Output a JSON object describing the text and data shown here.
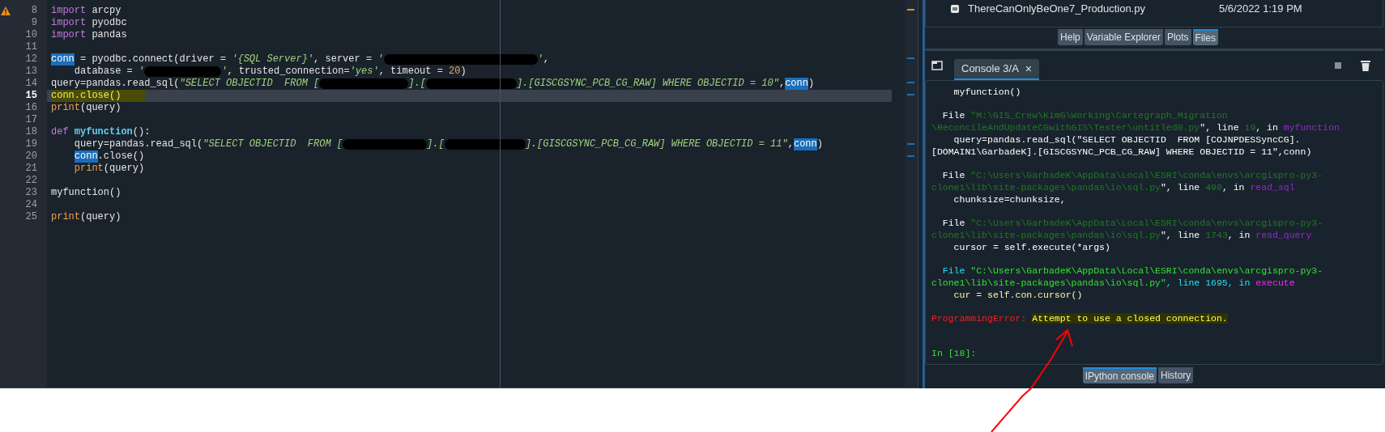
{
  "editor": {
    "lines": [
      {
        "number": "8",
        "warning": true,
        "current": false,
        "marked": false,
        "segments": [
          {
            "kind": "kw",
            "text": "import"
          },
          {
            "kind": "name",
            "text": " arcpy"
          }
        ]
      },
      {
        "number": "9",
        "warning": false,
        "current": false,
        "marked": false,
        "segments": [
          {
            "kind": "kw",
            "text": "import"
          },
          {
            "kind": "name",
            "text": " pyodbc"
          }
        ]
      },
      {
        "number": "10",
        "warning": false,
        "current": false,
        "marked": false,
        "segments": [
          {
            "kind": "kw",
            "text": "import"
          },
          {
            "kind": "name",
            "text": " pandas"
          }
        ]
      },
      {
        "number": "11",
        "warning": false,
        "current": false,
        "marked": false
      },
      {
        "number": "12",
        "warning": false,
        "current": false,
        "marked": false,
        "segments": [
          {
            "kind": "hl",
            "text": "conn"
          },
          {
            "kind": "name",
            "text": " = pyodbc.connect(driver = "
          },
          {
            "kind": "str",
            "text": "'{SQL Server}'"
          },
          {
            "kind": "name",
            "text": ", server = "
          },
          {
            "kind": "str",
            "text": "'"
          },
          {
            "kind": "redacted"
          },
          {
            "kind": "str",
            "text": "'"
          },
          {
            "kind": "name",
            "text": ","
          }
        ]
      },
      {
        "number": "13",
        "warning": false,
        "current": false,
        "marked": false,
        "segments": [
          {
            "kind": "name",
            "text": "    database = "
          },
          {
            "kind": "str",
            "text": "'"
          },
          {
            "kind": "redacted"
          },
          {
            "kind": "str",
            "text": "'"
          },
          {
            "kind": "name",
            "text": ", trusted_connection="
          },
          {
            "kind": "str",
            "text": "'yes'"
          },
          {
            "kind": "name",
            "text": ", timeout = "
          },
          {
            "kind": "num",
            "text": "20"
          },
          {
            "kind": "name",
            "text": ")"
          }
        ]
      },
      {
        "number": "14",
        "warning": false,
        "current": false,
        "marked": false,
        "segments": [
          {
            "kind": "name",
            "text": "query=pandas.read_sql("
          },
          {
            "kind": "str",
            "text": "\"SELECT OBJECTID  FROM ["
          },
          {
            "kind": "redacted"
          },
          {
            "kind": "str",
            "text": "].["
          },
          {
            "kind": "redacted"
          },
          {
            "kind": "str",
            "text": "].[GISCGSYNC_PCB_CG_RAW] WHERE OBJECTID = 10\""
          },
          {
            "kind": "name",
            "text": ","
          },
          {
            "kind": "hl",
            "text": "conn"
          },
          {
            "kind": "name",
            "text": ")"
          }
        ]
      },
      {
        "number": "15",
        "warning": false,
        "current": true,
        "marked": true,
        "segments": [
          {
            "kind": "name",
            "text": "conn.close()"
          }
        ]
      },
      {
        "number": "16",
        "warning": false,
        "current": false,
        "marked": false,
        "segments": [
          {
            "kind": "builtin",
            "text": "print"
          },
          {
            "kind": "name",
            "text": "(query)"
          }
        ]
      },
      {
        "number": "17",
        "warning": false,
        "current": false,
        "marked": false
      },
      {
        "number": "18",
        "warning": false,
        "current": false,
        "marked": false,
        "segments": [
          {
            "kind": "kw",
            "text": "def "
          },
          {
            "kind": "def",
            "text": "myfunction"
          },
          {
            "kind": "name",
            "text": "():"
          }
        ],
        "children": [
          {
            "number": "19",
            "warning": false,
            "current": false,
            "marked": false,
            "segments": [
              {
                "kind": "name",
                "text": "query=pandas.read_sql("
              },
              {
                "kind": "str",
                "text": "\"SELECT OBJECTID  FROM ["
              },
              {
                "kind": "redacted"
              },
              {
                "kind": "str",
                "text": "].["
              },
              {
                "kind": "redacted"
              },
              {
                "kind": "str",
                "text": "].[GISCGSYNC_PCB_CG_RAW] WHERE OBJECTID = 11\""
              },
              {
                "kind": "name",
                "text": ","
              },
              {
                "kind": "hl",
                "text": "conn"
              },
              {
                "kind": "name",
                "text": ")"
              }
            ]
          },
          {
            "number": "20",
            "warning": false,
            "current": false,
            "marked": false,
            "segments": [
              {
                "kind": "hl",
                "text": "conn"
              },
              {
                "kind": "name",
                "text": ".close()"
              }
            ]
          },
          {
            "number": "21",
            "warning": false,
            "current": false,
            "marked": false,
            "segments": [
              {
                "kind": "builtin",
                "text": "print"
              },
              {
                "kind": "name",
                "text": "(query)"
              }
            ]
          }
        ]
      },
      {
        "number": "22",
        "warning": false,
        "current": false,
        "marked": false
      },
      {
        "number": "23",
        "warning": false,
        "current": false,
        "marked": false,
        "segments": [
          {
            "kind": "name",
            "text": "myfunction()"
          }
        ]
      },
      {
        "number": "24",
        "warning": false,
        "current": false,
        "marked": false
      },
      {
        "number": "25",
        "warning": false,
        "current": false,
        "marked": false,
        "segments": [
          {
            "kind": "builtin",
            "text": "print"
          },
          {
            "kind": "name",
            "text": "(query)"
          }
        ]
      }
    ]
  },
  "files": {
    "row": {
      "name": "ThereCanOnlyBeOne7_Production.py",
      "date": "5/6/2022 1:19 PM"
    },
    "tabs": [
      {
        "label": "Help",
        "selected": false
      },
      {
        "label": "Variable Explorer",
        "selected": false
      },
      {
        "label": "Plots",
        "selected": false
      },
      {
        "label": "Files",
        "selected": true
      }
    ]
  },
  "console": {
    "tab": {
      "label": "Console 3/A",
      "close": "×"
    },
    "blocks": [
      {
        "lines": [
          {
            "segments": [
              {
                "kind": "plain",
                "text": "    myfunction()"
              }
            ]
          }
        ]
      },
      {
        "lines": [
          {
            "segments": [
              {
                "kind": "plain",
                "text": "  File "
              },
              {
                "kind": "path",
                "text": "\"M:\\GIS_Crew\\KimG\\Working\\Cartegraph_Migration"
              }
            ]
          },
          {
            "segments": [
              {
                "kind": "path",
                "text": "\\ReconcileAndUpdateCGwithGIS\\Tester\\untitled0.py"
              },
              {
                "kind": "plain",
                "text": "\", line "
              },
              {
                "kind": "num",
                "text": "19"
              },
              {
                "kind": "plain",
                "text": ", in "
              },
              {
                "kind": "func",
                "text": "myfunction"
              }
            ]
          },
          {
            "segments": [
              {
                "kind": "plain",
                "text": "    query=pandas.read_sql(\"SELECT OBJECTID  FROM [COJNPDESSyncCG]."
              }
            ]
          },
          {
            "segments": [
              {
                "kind": "plain",
                "text": "[DOMAIN1\\GarbadeK].[GISCGSYNC_PCB_CG_RAW] WHERE OBJECTID = 11\",conn)"
              }
            ]
          }
        ]
      },
      {
        "lines": [
          {
            "segments": [
              {
                "kind": "plain",
                "text": "  File "
              },
              {
                "kind": "path",
                "text": "\"C:\\Users\\GarbadeK\\AppData\\Local\\ESRI\\conda\\envs\\arcgispro-py3-"
              }
            ]
          },
          {
            "segments": [
              {
                "kind": "path",
                "text": "clone1\\lib\\site-packages\\pandas\\io\\sql.py"
              },
              {
                "kind": "plain",
                "text": "\", line "
              },
              {
                "kind": "num",
                "text": "490"
              },
              {
                "kind": "plain",
                "text": ", in "
              },
              {
                "kind": "func",
                "text": "read_sql"
              }
            ]
          },
          {
            "segments": [
              {
                "kind": "plain",
                "text": "    chunksize=chunksize,"
              }
            ]
          }
        ]
      },
      {
        "lines": [
          {
            "segments": [
              {
                "kind": "plain",
                "text": "  File "
              },
              {
                "kind": "path",
                "text": "\"C:\\Users\\GarbadeK\\AppData\\Local\\ESRI\\conda\\envs\\arcgispro-py3-"
              }
            ]
          },
          {
            "segments": [
              {
                "kind": "path",
                "text": "clone1\\lib\\site-packages\\pandas\\io\\sql.py"
              },
              {
                "kind": "plain",
                "text": "\", line "
              },
              {
                "kind": "num",
                "text": "1743"
              },
              {
                "kind": "plain",
                "text": ", in "
              },
              {
                "kind": "func",
                "text": "read_query"
              }
            ]
          },
          {
            "segments": [
              {
                "kind": "plain",
                "text": "    cursor = self.execute(*args)"
              }
            ]
          }
        ]
      },
      {
        "lines": [
          {
            "segments": [
              {
                "kind": "cyan",
                "text": "  File "
              },
              {
                "kind": "bright",
                "text": "\"C:\\Users\\GarbadeK\\AppData\\Local\\ESRI\\conda\\envs\\arcgispro-py3-"
              }
            ]
          },
          {
            "segments": [
              {
                "kind": "bright",
                "text": "clone1\\lib\\site-packages\\pandas\\io\\sql.py\""
              },
              {
                "kind": "cyan",
                "text": ", line 1695, in "
              },
              {
                "kind": "magenta",
                "text": "execute"
              }
            ]
          },
          {
            "segments": [
              {
                "kind": "yellow",
                "text": "    cur = self.con.cursor()"
              }
            ]
          }
        ]
      },
      {
        "lines": [
          {
            "segments": [
              {
                "kind": "err",
                "text": "ProgrammingError: "
              },
              {
                "kind": "errmsg",
                "text": "Attempt to use a closed connection."
              }
            ]
          }
        ]
      }
    ],
    "prompt": "In [18]:"
  },
  "bottom_tabs": [
    {
      "label": "IPython console",
      "selected": true
    },
    {
      "label": "History",
      "selected": false
    }
  ]
}
